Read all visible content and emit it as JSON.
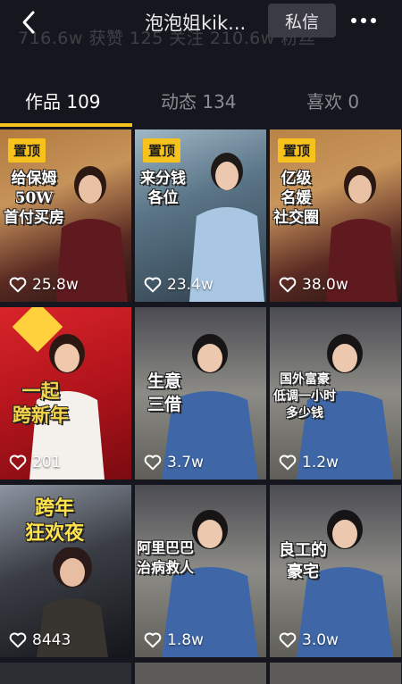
{
  "header": {
    "title": "泡泡姐kik...",
    "dm_label": "私信",
    "stats_ghost": "716.6w 获赞   125 关注   210.6w 粉丝"
  },
  "tabs": [
    {
      "label": "作品 109",
      "active": true
    },
    {
      "label": "动态 134",
      "active": false
    },
    {
      "label": "喜欢 0",
      "active": false
    }
  ],
  "videos": [
    {
      "pinned": true,
      "pin_label": "置顶",
      "caption": "给保姆\n50W\n首付买房",
      "likes": "25.8w"
    },
    {
      "pinned": true,
      "pin_label": "置顶",
      "caption": "来分钱\n各位",
      "likes": "23.4w"
    },
    {
      "pinned": true,
      "pin_label": "置顶",
      "caption": "亿级\n名媛\n社交圈",
      "likes": "38.0w"
    },
    {
      "pinned": false,
      "caption": "一起\n跨新年",
      "likes": "201"
    },
    {
      "pinned": false,
      "caption": "生意\n三借",
      "likes": "3.7w"
    },
    {
      "pinned": false,
      "caption": "国外富豪\n低调一小时\n多少钱",
      "likes": "1.2w"
    },
    {
      "pinned": false,
      "caption": "跨年\n狂欢夜",
      "likes": "8443"
    },
    {
      "pinned": false,
      "caption": "阿里巴巴\n治病救人",
      "likes": "1.8w"
    },
    {
      "pinned": false,
      "caption": "良工的\n豪宅",
      "likes": "3.0w"
    }
  ],
  "colors": {
    "accent": "#f8c21d",
    "background": "#15161e"
  }
}
